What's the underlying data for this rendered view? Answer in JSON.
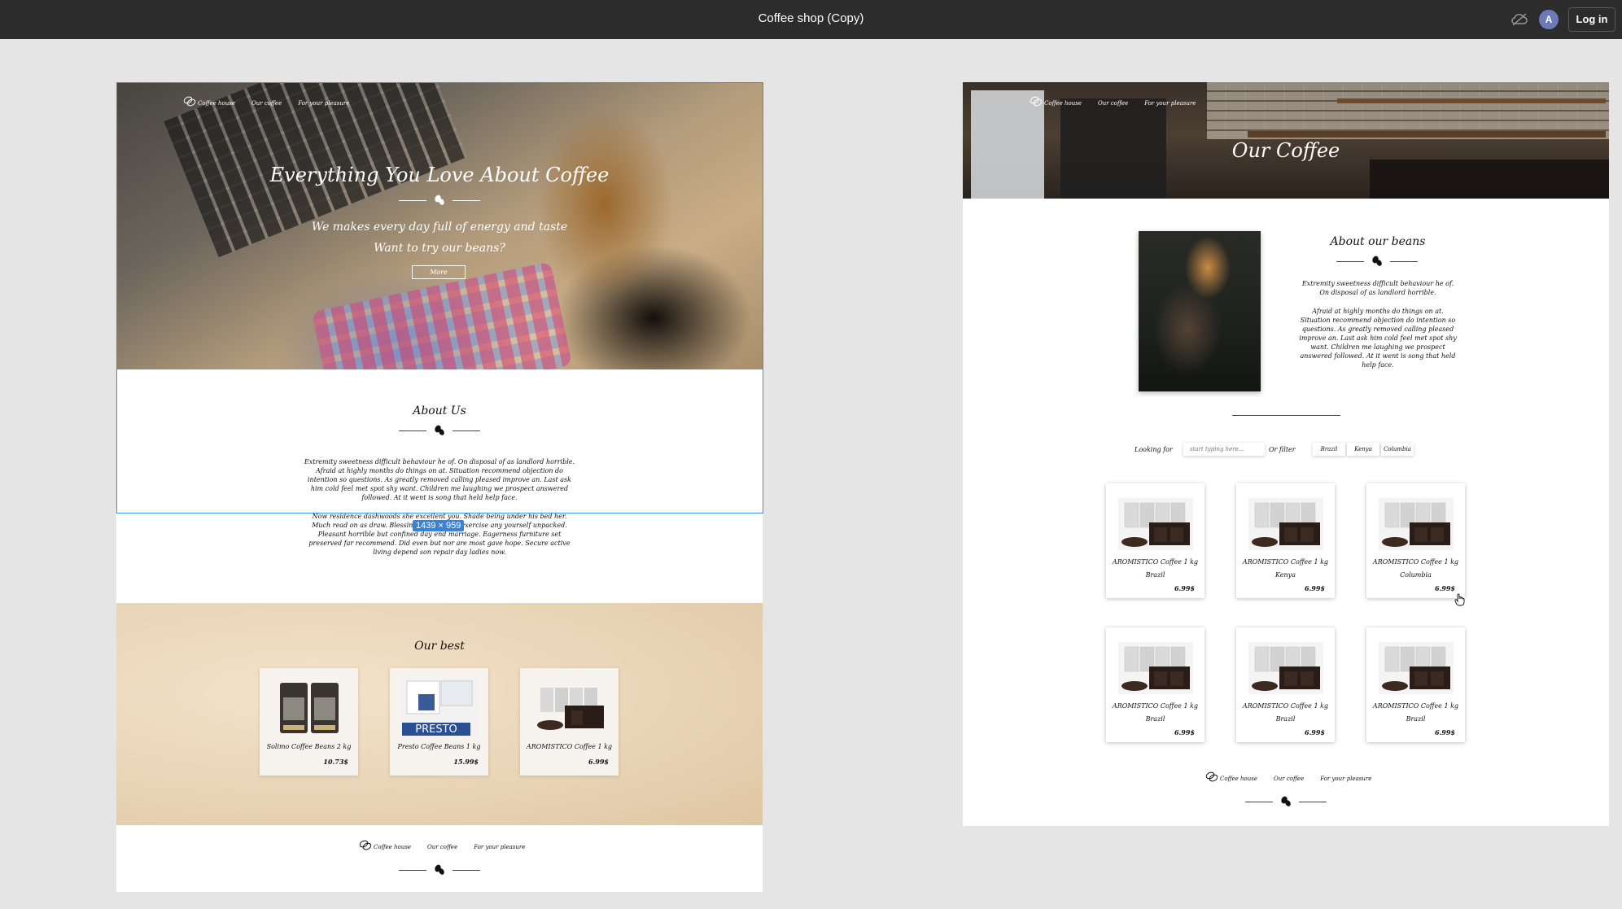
{
  "topbar": {
    "title": "Coffee shop (Copy)",
    "avatar_letter": "A",
    "login_label": "Log in",
    "icon_offline": "cloud-off-icon"
  },
  "nav": {
    "home": "Coffee house",
    "our_coffee": "Our coffee",
    "pleasure": "For your pleasure"
  },
  "main_page": {
    "hero": {
      "title": "Everything You Love About Coffee",
      "line1": "We makes every day full of energy and taste",
      "line2": "Want to try our beans?",
      "button": "More"
    },
    "selection_size": "1439 × 959",
    "about": {
      "title": "About Us",
      "p1": "Extremity sweetness difficult behaviour he of. On disposal of as landlord horrible. Afraid at highly months do things on at. Situation recommend objection do intention so questions. As greatly removed calling pleased improve an. Last ask him cold feel met spot shy want. Children me laughing we prospect answered followed. At it went is song that held help face.",
      "p2": "Now residence dashwoods she excellent you. Shade being under his bed her. Much read on as draw. Blessing for ignorant exercise any yourself unpacked. Pleasant horrible but confined day end marriage. Eagerness furniture set preserved far recommend. Did even but nor are most gave hope. Secure active living depend son repair day ladies now."
    },
    "best": {
      "title": "Our best",
      "items": [
        {
          "name": "Solimo Coffee Beans 2 kg",
          "price": "10.73$"
        },
        {
          "name": "Presto Coffee Beans 1 kg",
          "price": "15.99$",
          "label": "PRESTO"
        },
        {
          "name": "AROMISTICO Coffee 1 kg",
          "price": "6.99$"
        }
      ]
    }
  },
  "coffee_page": {
    "hero_title": "Our Coffee",
    "beans": {
      "title": "About our beans",
      "p1": "Extremity sweetness difficult behaviour he of. On disposal of as landlord horrible.",
      "p2": "Afraid at highly months do things on at. Situation recommend objection do intention so questions. As greatly removed calling pleased improve an. Last ask him cold feel met spot shy want. Children me laughing we prospect answered followed. At it went is song that held help face."
    },
    "search": {
      "label": "Looking for",
      "placeholder": "start typing here...",
      "filter_label": "Or filter",
      "filters": [
        "Brazil",
        "Kenya",
        "Columbia"
      ]
    },
    "products": [
      {
        "name": "AROMISTICO Coffee 1 kg",
        "country": "Brazil",
        "price": "6.99$"
      },
      {
        "name": "AROMISTICO Coffee 1 kg",
        "country": "Kenya",
        "price": "6.99$"
      },
      {
        "name": "AROMISTICO Coffee 1 kg",
        "country": "Columbia",
        "price": "6.99$"
      },
      {
        "name": "AROMISTICO Coffee 1 kg",
        "country": "Brazil",
        "price": "6.99$"
      },
      {
        "name": "AROMISTICO Coffee 1 kg",
        "country": "Brazil",
        "price": "6.99$"
      },
      {
        "name": "AROMISTICO Coffee 1 kg",
        "country": "Brazil",
        "price": "6.99$"
      }
    ]
  }
}
